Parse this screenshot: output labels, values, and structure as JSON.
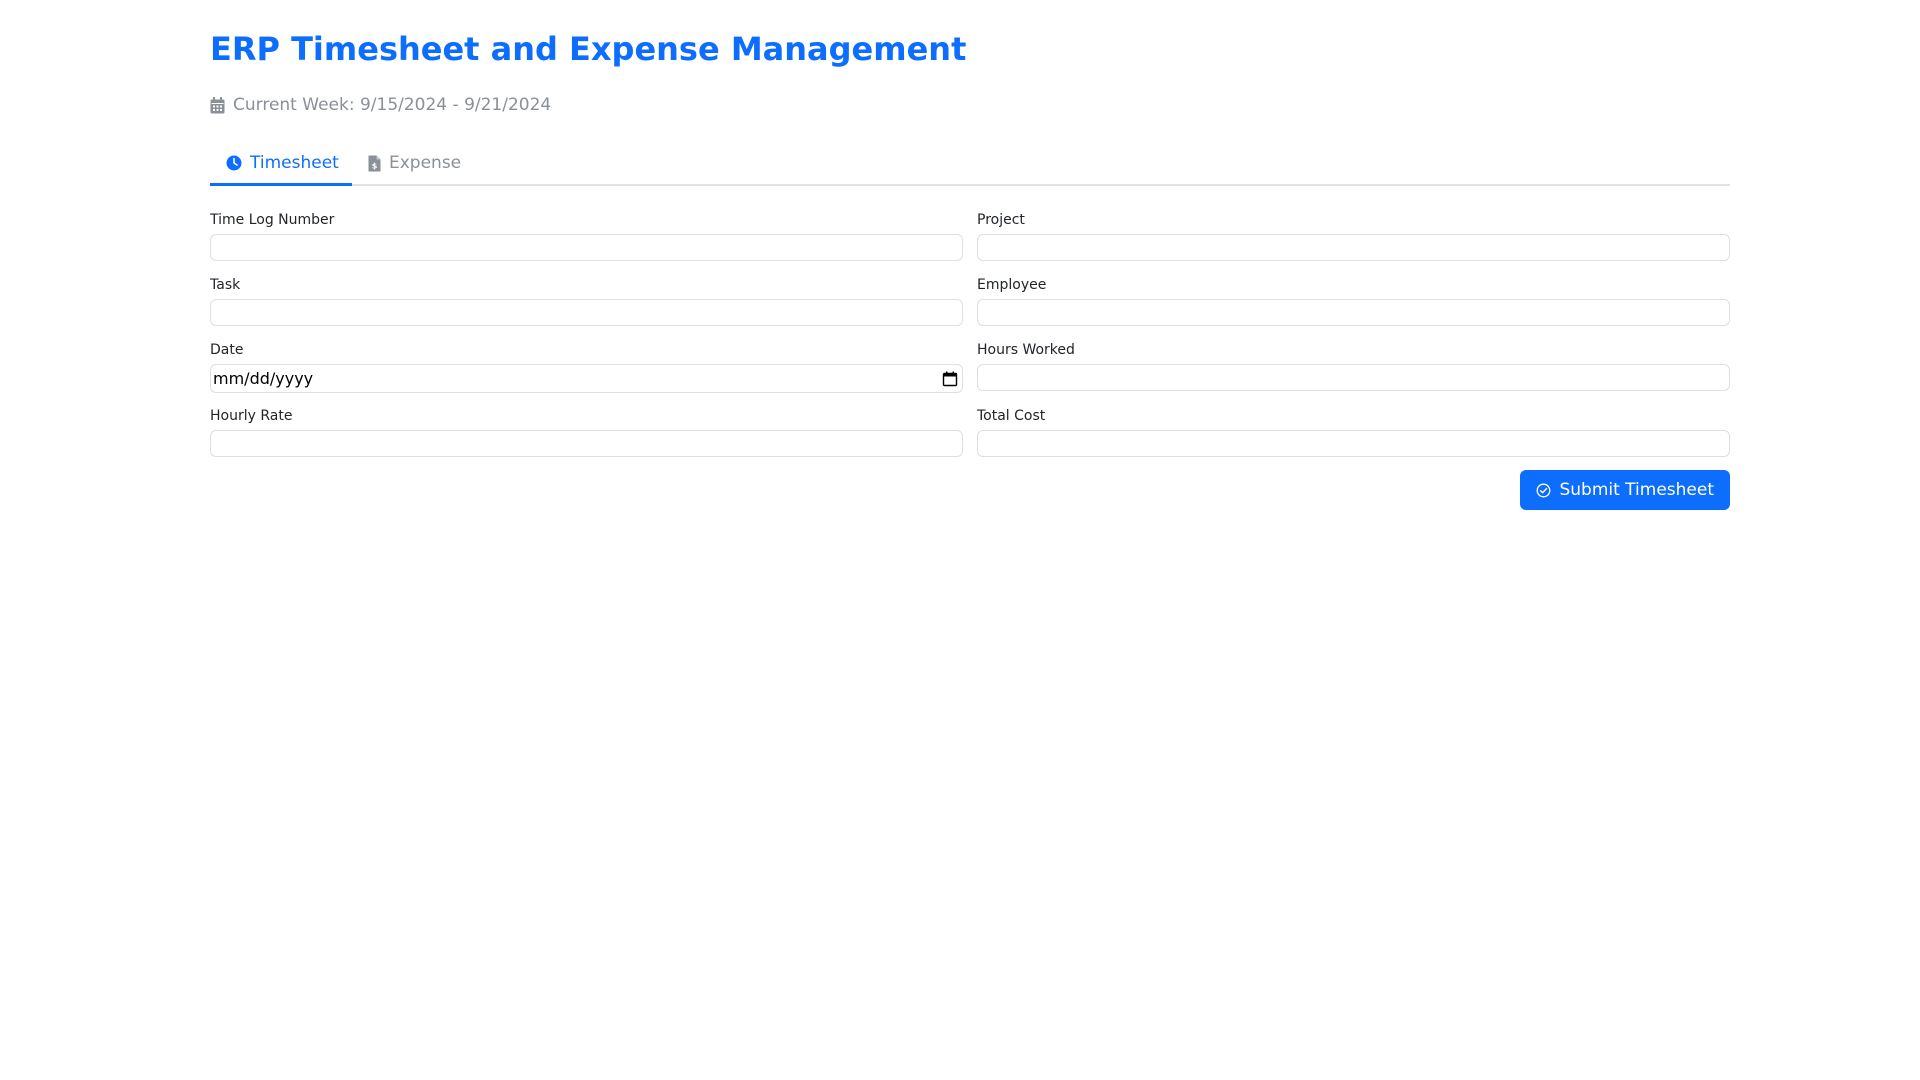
{
  "header": {
    "title": "ERP Timesheet and Expense Management",
    "week_label": "Current Week: 9/15/2024 - 9/21/2024",
    "week_icon": "calendar-icon"
  },
  "tabs": [
    {
      "label": "Timesheet",
      "icon": "clock-icon",
      "active": true
    },
    {
      "label": "Expense",
      "icon": "receipt-icon",
      "active": false
    }
  ],
  "form": {
    "fields": {
      "time_log_number": {
        "label": "Time Log Number",
        "value": ""
      },
      "project": {
        "label": "Project",
        "value": ""
      },
      "task": {
        "label": "Task",
        "value": ""
      },
      "employee": {
        "label": "Employee",
        "value": ""
      },
      "date": {
        "label": "Date",
        "placeholder": "mm/dd/yyyy"
      },
      "hours_worked": {
        "label": "Hours Worked",
        "value": ""
      },
      "hourly_rate": {
        "label": "Hourly Rate",
        "value": ""
      },
      "total_cost": {
        "label": "Total Cost",
        "value": ""
      }
    },
    "submit_label": "Submit Timesheet",
    "submit_icon": "check-circle-icon"
  },
  "colors": {
    "primary": "#0d6efd",
    "muted": "#8a9097",
    "text": "#212529",
    "border": "#dee2e6"
  }
}
